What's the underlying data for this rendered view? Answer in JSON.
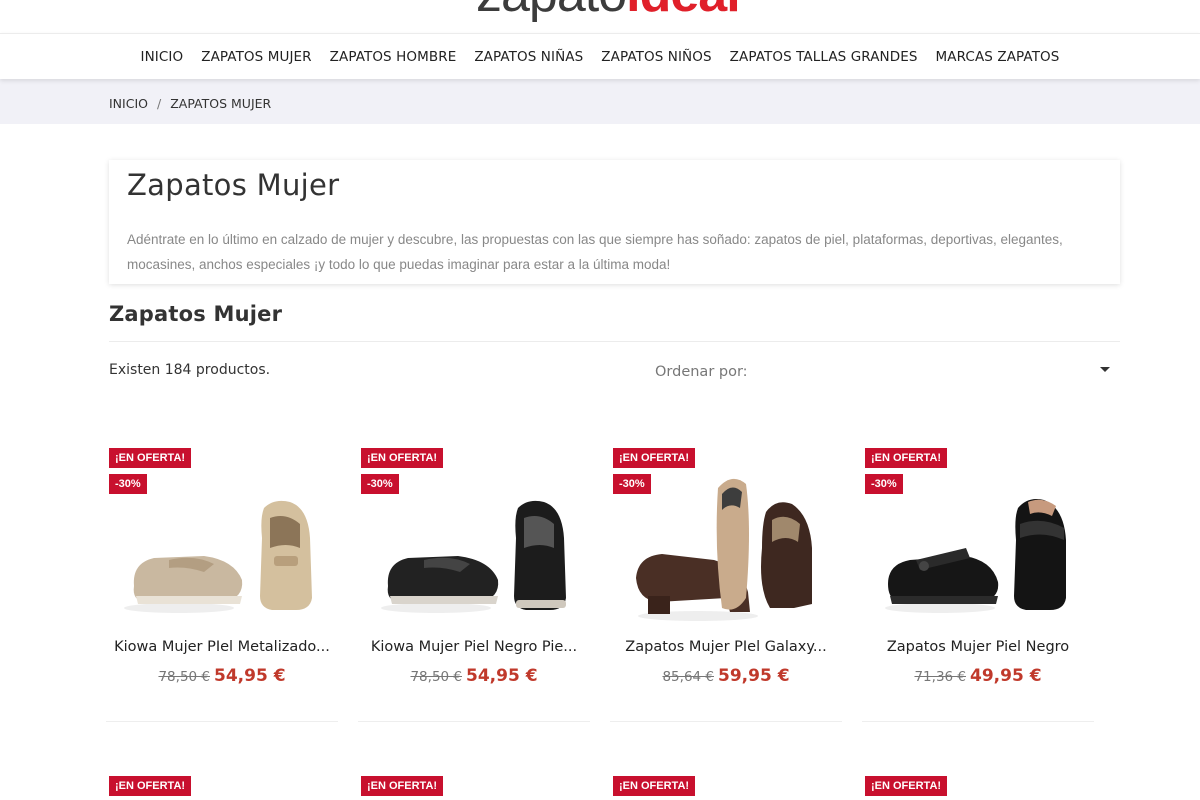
{
  "logo": {
    "part1": "zapato",
    "part2": "ideal"
  },
  "nav": [
    "INICIO",
    "ZAPATOS MUJER",
    "ZAPATOS HOMBRE",
    "ZAPATOS NIÑAS",
    "ZAPATOS NIÑOS",
    "ZAPATOS TALLAS GRANDES",
    "MARCAS ZAPATOS"
  ],
  "breadcrumb": {
    "home": "INICIO",
    "separator": "/",
    "current": "ZAPATOS MUJER"
  },
  "category": {
    "title": "Zapatos Mujer",
    "description": "Adéntrate en lo último en calzado de mujer y descubre, las propuestas con las que siempre has soñado: zapatos de piel, plataformas, deportivas, elegantes, mocasines, anchos especiales ¡y todo lo que puedas imaginar para estar a la última moda!"
  },
  "listing": {
    "title": "Zapatos Mujer",
    "count_text": "Existen 184 productos.",
    "sort_label": "Ordenar por:"
  },
  "products": [
    {
      "name": "Kiowa Mujer PIel Metalizado...",
      "old_price": "78,50 €",
      "price": "54,95 €",
      "badge_offer": "¡EN OFERTA!",
      "badge_discount": "-30%"
    },
    {
      "name": "Kiowa Mujer Piel Negro Pie...",
      "old_price": "78,50 €",
      "price": "54,95 €",
      "badge_offer": "¡EN OFERTA!",
      "badge_discount": "-30%"
    },
    {
      "name": "Zapatos Mujer PIel Galaxy...",
      "old_price": "85,64 €",
      "price": "59,95 €",
      "badge_offer": "¡EN OFERTA!",
      "badge_discount": "-30%"
    },
    {
      "name": "Zapatos Mujer Piel Negro",
      "old_price": "71,36 €",
      "price": "49,95 €",
      "badge_offer": "¡EN OFERTA!",
      "badge_discount": "-30%"
    }
  ],
  "products_row2": [
    {
      "badge_offer": "¡EN OFERTA!"
    },
    {
      "badge_offer": "¡EN OFERTA!"
    },
    {
      "badge_offer": "¡EN OFERTA!"
    },
    {
      "badge_offer": "¡EN OFERTA!"
    }
  ],
  "colors": {
    "accent": "#c8102e",
    "price": "#c0392b",
    "breadcrumb_bg": "#f1f1f7"
  }
}
